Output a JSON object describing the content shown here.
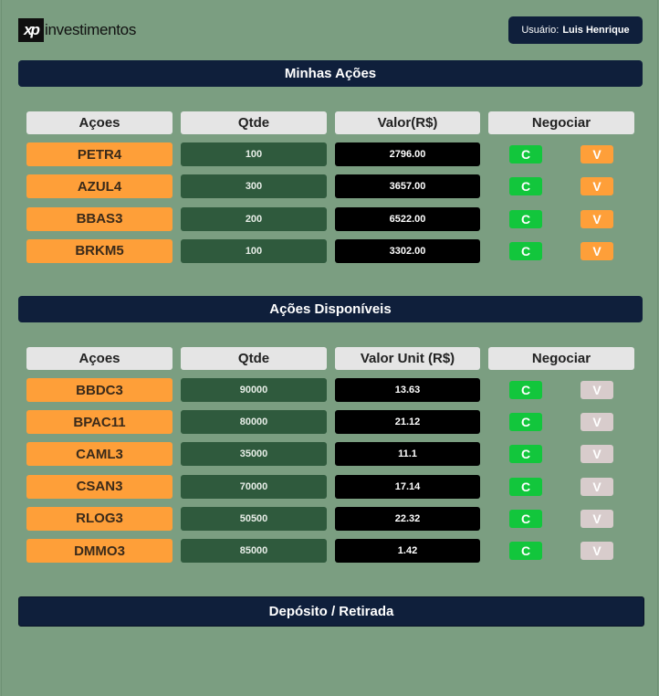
{
  "header": {
    "logo_mark": "xp",
    "logo_text": "investimentos",
    "user_label": "Usuário:",
    "user_name": "Luis Henrique"
  },
  "minhas": {
    "title": "Minhas Ações",
    "headers": [
      "Açoes",
      "Qtde",
      "Valor(R$)",
      "Negociar"
    ],
    "rows": [
      {
        "stock": "PETR4",
        "qty": "100",
        "value": "2796.00"
      },
      {
        "stock": "AZUL4",
        "qty": "300",
        "value": "3657.00"
      },
      {
        "stock": "BBAS3",
        "qty": "200",
        "value": "6522.00"
      },
      {
        "stock": "BRKM5",
        "qty": "100",
        "value": "3302.00"
      }
    ]
  },
  "disponiveis": {
    "title": "Ações Disponíveis",
    "headers": [
      "Açoes",
      "Qtde",
      "Valor Unit (R$)",
      "Negociar"
    ],
    "rows": [
      {
        "stock": "BBDC3",
        "qty": "90000",
        "value": "13.63"
      },
      {
        "stock": "BPAC11",
        "qty": "80000",
        "value": "21.12"
      },
      {
        "stock": "CAML3",
        "qty": "35000",
        "value": "11.1"
      },
      {
        "stock": "CSAN3",
        "qty": "70000",
        "value": "17.14"
      },
      {
        "stock": "RLOG3",
        "qty": "50500",
        "value": "22.32"
      },
      {
        "stock": "DMMO3",
        "qty": "85000",
        "value": "1.42"
      }
    ]
  },
  "buttons": {
    "buy": "C",
    "sell": "V"
  },
  "deposito": {
    "title": "Depósito / Retirada"
  },
  "colors": {
    "background": "#7b9e81",
    "navy": "#0f1f3b",
    "orange": "#fe9f39",
    "green_dark": "#2f5a3d",
    "buy_green": "#12c63c",
    "sell_disabled": "#d8cccc"
  }
}
